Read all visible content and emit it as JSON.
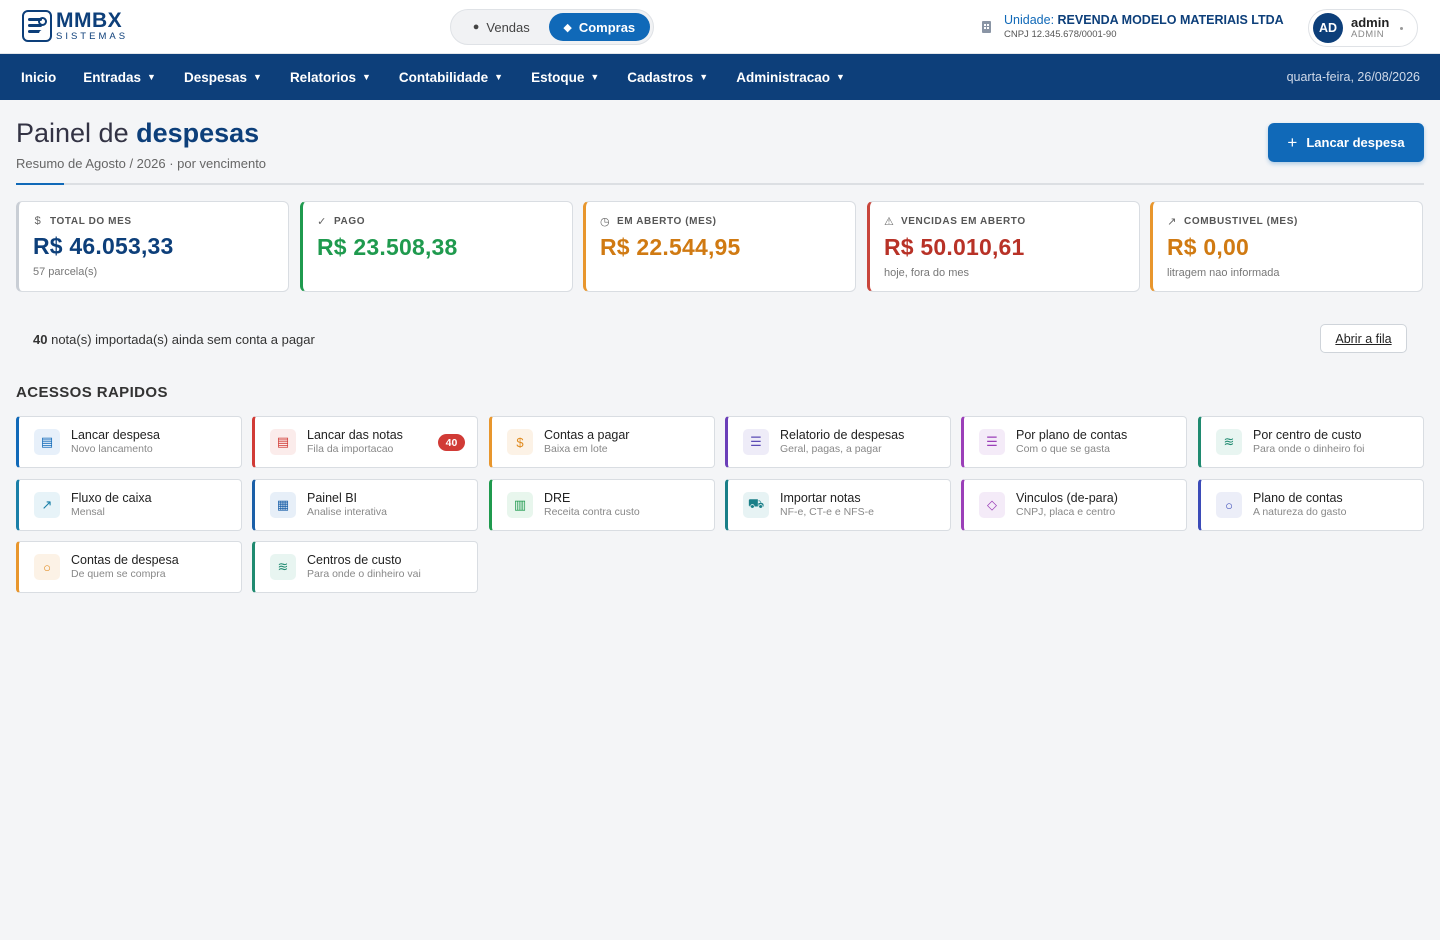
{
  "brand": {
    "name": "MMBX",
    "sub": "SISTEMAS"
  },
  "mode_toggle": {
    "vendas": "Vendas",
    "compras": "Compras",
    "active": "Compras"
  },
  "unit": {
    "label": "Unidade:",
    "name": "REVENDA MODELO MATERIAIS LTDA",
    "cnpj": "CNPJ 12.345.678/0001-90"
  },
  "user": {
    "initials": "AD",
    "name": "admin",
    "role": "ADMIN"
  },
  "nav": {
    "items": [
      {
        "label": "Inicio",
        "caret": ""
      },
      {
        "label": "Entradas",
        "caret": "▼"
      },
      {
        "label": "Despesas",
        "caret": "▼"
      },
      {
        "label": "Relatorios",
        "caret": "▼"
      },
      {
        "label": "Contabilidade",
        "caret": "▼"
      },
      {
        "label": "Estoque",
        "caret": "▼"
      },
      {
        "label": "Cadastros",
        "caret": "▼"
      },
      {
        "label": "Administracao",
        "caret": "▼"
      }
    ],
    "date": "quarta-feira, 26/08/2026"
  },
  "header": {
    "title_light": "Painel de",
    "title_bold": "despesas",
    "subtitle": "Resumo de Agosto / 2026 · por vencimento",
    "primary_button": "Lancar despesa"
  },
  "kpis": [
    {
      "icon": "dollar-icon",
      "glyph": "$",
      "label": "TOTAL DO MES",
      "value": "R$ 46.053,33",
      "note": "57 parcela(s)",
      "color": "#0d3f7a",
      "accent": "#c9ced5"
    },
    {
      "icon": "check-icon",
      "glyph": "✓",
      "label": "PAGO",
      "value": "R$ 23.508,38",
      "note": "",
      "color": "#1f9a4e",
      "accent": "#1f9a4e"
    },
    {
      "icon": "clock-icon",
      "glyph": "◷",
      "label": "EM ABERTO (MES)",
      "value": "R$ 22.544,95",
      "note": "",
      "color": "#d07a12",
      "accent": "#e8962d"
    },
    {
      "icon": "warning-icon",
      "glyph": "⚠",
      "label": "VENCIDAS EM ABERTO",
      "value": "R$ 50.010,61",
      "note": "hoje, fora do mes",
      "color": "#b83227",
      "accent": "#c8453b"
    },
    {
      "icon": "trend-up-icon",
      "glyph": "↗",
      "label": "COMBUSTIVEL (MES)",
      "value": "R$ 0,00",
      "note": "litragem nao informada",
      "color": "#d07a12",
      "accent": "#e8962d"
    }
  ],
  "notice": {
    "count": "40",
    "text": "nota(s) importada(s) ainda sem conta a pagar",
    "button": "Abrir a fila"
  },
  "quick_access": {
    "title": "ACESSOS RAPIDOS",
    "tiles": [
      {
        "name": "lancar-despesa",
        "icon": "document-icon",
        "glyph": "▤",
        "title": "Lancar despesa",
        "sub": "Novo lancamento",
        "accent": "#1069b8",
        "icon_color": "#1069b8",
        "icon_bg": "#e7f0fa",
        "badge": ""
      },
      {
        "name": "lancar-das-notas",
        "icon": "document-red-icon",
        "glyph": "▤",
        "title": "Lancar das notas",
        "sub": "Fila da importacao",
        "accent": "#d13b36",
        "icon_color": "#d13b36",
        "icon_bg": "#fbeceb",
        "badge": "40"
      },
      {
        "name": "contas-a-pagar",
        "icon": "dollar-icon",
        "glyph": "$",
        "title": "Contas a pagar",
        "sub": "Baixa em lote",
        "accent": "#e8962d",
        "icon_color": "#e08a1e",
        "icon_bg": "#fcf2e6",
        "badge": ""
      },
      {
        "name": "relatorio-de-despesas",
        "icon": "list-icon",
        "glyph": "☰",
        "title": "Relatorio de despesas",
        "sub": "Geral, pagas, a pagar",
        "accent": "#6b3fb8",
        "icon_color": "#5b4bb5",
        "icon_bg": "#eeecf8",
        "badge": ""
      },
      {
        "name": "por-plano-de-contas",
        "icon": "list-icon",
        "glyph": "☰",
        "title": "Por plano de contas",
        "sub": "Com o que se gasta",
        "accent": "#9b3fb8",
        "icon_color": "#9b3fb8",
        "icon_bg": "#f4ebf8",
        "badge": ""
      },
      {
        "name": "por-centro-de-custo",
        "icon": "layers-icon",
        "glyph": "≋",
        "title": "Por centro de custo",
        "sub": "Para onde o dinheiro foi",
        "accent": "#1f8a70",
        "icon_color": "#1f8a70",
        "icon_bg": "#e8f5f1",
        "badge": ""
      },
      {
        "name": "fluxo-de-caixa",
        "icon": "trend-up-icon",
        "glyph": "↗",
        "title": "Fluxo de caixa",
        "sub": "Mensal",
        "accent": "#1a7fa8",
        "icon_color": "#1a7fa8",
        "icon_bg": "#e7f3f8",
        "badge": ""
      },
      {
        "name": "painel-bi",
        "icon": "dashboard-icon",
        "glyph": "▦",
        "title": "Painel BI",
        "sub": "Analise interativa",
        "accent": "#1a5fa8",
        "icon_color": "#1a5fa8",
        "icon_bg": "#e7eff8",
        "badge": ""
      },
      {
        "name": "dre",
        "icon": "bar-chart-icon",
        "glyph": "▥",
        "title": "DRE",
        "sub": "Receita contra custo",
        "accent": "#1f9a4e",
        "icon_color": "#1f9a4e",
        "icon_bg": "#e8f6ed",
        "badge": ""
      },
      {
        "name": "importar-notas",
        "icon": "truck-icon",
        "glyph": "⛟",
        "title": "Importar notas",
        "sub": "NF-e, CT-e e NFS-e",
        "accent": "#1a7f88",
        "icon_color": "#1a7f88",
        "icon_bg": "#e7f3f4",
        "badge": ""
      },
      {
        "name": "vinculos-de-para",
        "icon": "tag-icon",
        "glyph": "◇",
        "title": "Vinculos (de-para)",
        "sub": "CNPJ, placa e centro",
        "accent": "#9b3fb8",
        "icon_color": "#9b3fb8",
        "icon_bg": "#f4ebf8",
        "badge": ""
      },
      {
        "name": "plano-de-contas",
        "icon": "circle-icon",
        "glyph": "○",
        "title": "Plano de contas",
        "sub": "A natureza do gasto",
        "accent": "#3b4bb8",
        "icon_color": "#3b4bb8",
        "icon_bg": "#eceef8",
        "badge": ""
      },
      {
        "name": "contas-de-despesa",
        "icon": "circle-icon",
        "glyph": "○",
        "title": "Contas de despesa",
        "sub": "De quem se compra",
        "accent": "#e8962d",
        "icon_color": "#e08a1e",
        "icon_bg": "#fcf2e6",
        "badge": ""
      },
      {
        "name": "centros-de-custo",
        "icon": "layers-icon",
        "glyph": "≋",
        "title": "Centros de custo",
        "sub": "Para onde o dinheiro vai",
        "accent": "#1f8a70",
        "icon_color": "#1f8a70",
        "icon_bg": "#e8f5f1",
        "badge": ""
      }
    ]
  }
}
